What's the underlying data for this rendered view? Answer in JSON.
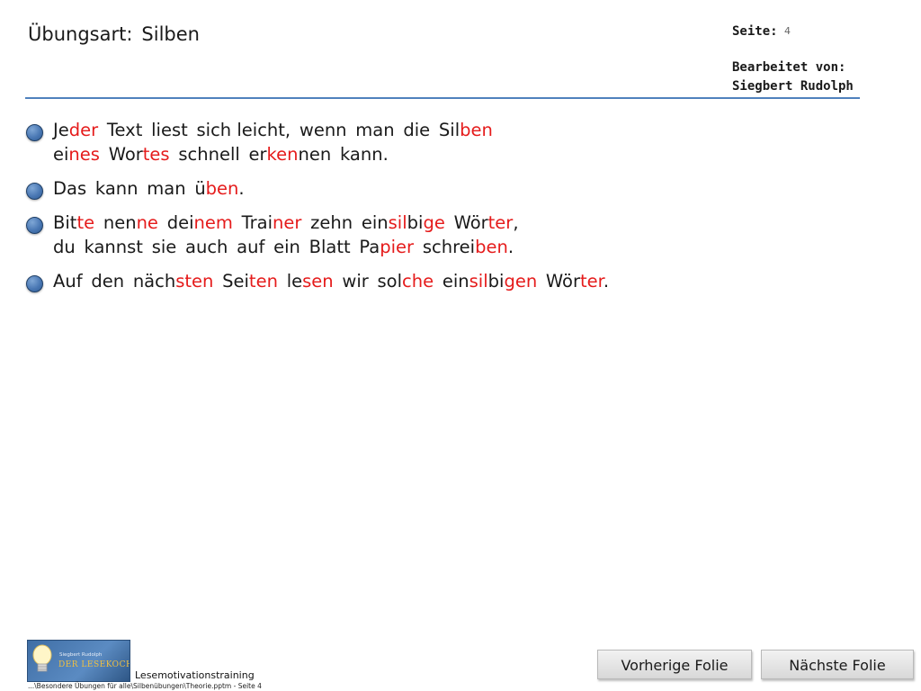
{
  "header": {
    "exercise_label": "Übungsart:",
    "exercise_value": "Silben",
    "page_label": "Seite:",
    "page_number": "4",
    "edited_by_label": "Bearbeitet  von:",
    "edited_by_name": "Siegbert  Rudolph"
  },
  "accent_colors": {
    "highlight": "#e51b1b",
    "rule": "#4f81bd",
    "bullet": "#4a78b4"
  },
  "content": {
    "items": [
      {
        "lines": [
          [
            [
              "Je",
              "der"
            ],
            [
              "Text"
            ],
            [
              "liest"
            ],
            [
              "sich leicht,"
            ],
            [
              "wenn"
            ],
            [
              "man"
            ],
            [
              "die"
            ],
            [
              "Sil",
              "ben"
            ]
          ],
          [
            [
              "ei",
              "nes"
            ],
            [
              "Wor",
              "tes"
            ],
            [
              "schnell"
            ],
            [
              "er",
              "ken",
              "nen"
            ],
            [
              "kann."
            ]
          ]
        ]
      },
      {
        "lines": [
          [
            [
              "Das"
            ],
            [
              "kann"
            ],
            [
              "man"
            ],
            [
              "ü",
              "ben",
              "."
            ]
          ]
        ]
      },
      {
        "lines": [
          [
            [
              "Bit",
              "te"
            ],
            [
              "nen",
              "ne"
            ],
            [
              "dei",
              "nem"
            ],
            [
              "Trai",
              "ner"
            ],
            [
              "zehn"
            ],
            [
              "ein",
              "sil",
              "bi",
              "ge"
            ],
            [
              "Wör",
              "ter",
              ","
            ]
          ],
          [
            [
              "du"
            ],
            [
              "kannst"
            ],
            [
              "sie"
            ],
            [
              "auch"
            ],
            [
              "auf"
            ],
            [
              "ein"
            ],
            [
              "Blatt"
            ],
            [
              "Pa",
              "pier"
            ],
            [
              "schrei",
              "ben",
              "."
            ]
          ]
        ]
      },
      {
        "lines": [
          [
            [
              "Auf"
            ],
            [
              "den"
            ],
            [
              "näch",
              "sten"
            ],
            [
              "Sei",
              "ten"
            ],
            [
              "le",
              "sen"
            ],
            [
              "wir"
            ],
            [
              "sol",
              "che"
            ],
            [
              "ein",
              "sil",
              "bi",
              "gen"
            ],
            [
              "Wör",
              "ter",
              "."
            ]
          ]
        ]
      }
    ]
  },
  "footer": {
    "logo_subtitle": "Siegbert Rudolph",
    "logo_brand": "DER LESEKOCH",
    "label": "Lesemotivationstraining",
    "path": "...\\Besondere Übungen für alle\\Silbenübungen\\Theorie.pptm - Seite 4"
  },
  "nav": {
    "prev_label": "Vorherige Folie",
    "next_label": "Nächste Folie"
  }
}
